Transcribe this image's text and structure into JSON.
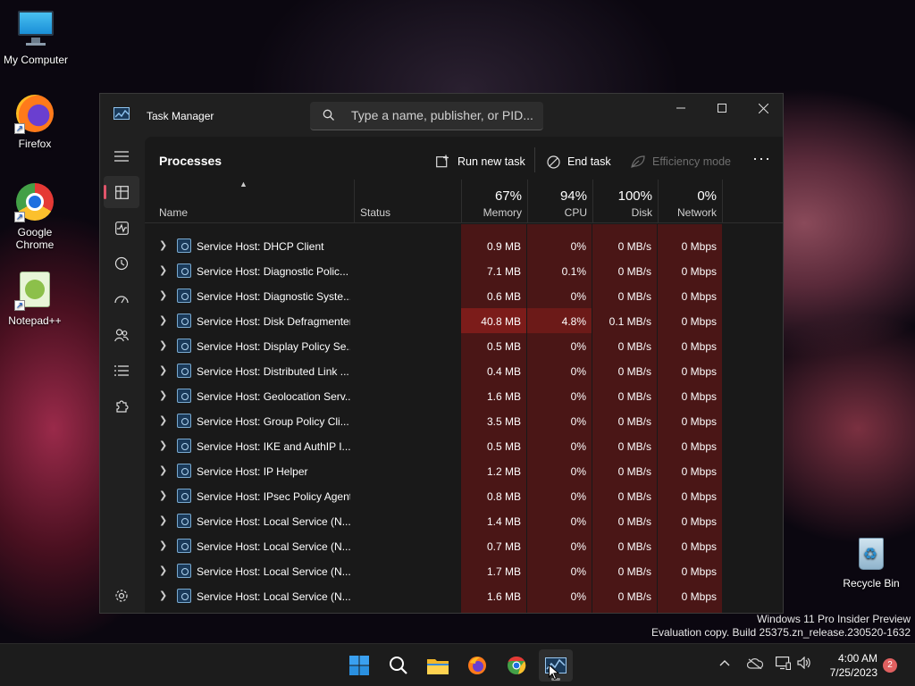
{
  "desktop": {
    "icons": [
      {
        "label": "My Computer",
        "icon": "computer-icon"
      },
      {
        "label": "Firefox",
        "icon": "firefox-icon"
      },
      {
        "label": "Google Chrome",
        "icon": "chrome-icon"
      },
      {
        "label": "Notepad++",
        "icon": "notepadpp-icon"
      },
      {
        "label": "Recycle Bin",
        "icon": "recycle-bin-icon"
      }
    ]
  },
  "window": {
    "title": "Task Manager",
    "search_placeholder": "Type a name, publisher, or PID..."
  },
  "toolbar": {
    "section_title": "Processes",
    "run_new_task": "Run new task",
    "end_task": "End task",
    "efficiency_mode": "Efficiency mode",
    "more": "···"
  },
  "columns": {
    "name": "Name",
    "status": "Status",
    "memory": {
      "label": "Memory",
      "pct": "67%"
    },
    "cpu": {
      "label": "CPU",
      "pct": "94%"
    },
    "disk": {
      "label": "Disk",
      "pct": "100%"
    },
    "network": {
      "label": "Network",
      "pct": "0%"
    }
  },
  "processes": [
    {
      "name": "Service Host: DHCP Client",
      "memory": "0.9 MB",
      "cpu": "0%",
      "disk": "0 MB/s",
      "network": "0 Mbps"
    },
    {
      "name": "Service Host: Diagnostic Polic...",
      "memory": "7.1 MB",
      "cpu": "0.1%",
      "disk": "0 MB/s",
      "network": "0 Mbps"
    },
    {
      "name": "Service Host: Diagnostic Syste...",
      "memory": "0.6 MB",
      "cpu": "0%",
      "disk": "0 MB/s",
      "network": "0 Mbps"
    },
    {
      "name": "Service Host: Disk Defragmenter",
      "memory": "40.8 MB",
      "cpu": "4.8%",
      "disk": "0.1 MB/s",
      "network": "0 Mbps",
      "hot": true
    },
    {
      "name": "Service Host: Display Policy Se...",
      "memory": "0.5 MB",
      "cpu": "0%",
      "disk": "0 MB/s",
      "network": "0 Mbps"
    },
    {
      "name": "Service Host: Distributed Link ...",
      "memory": "0.4 MB",
      "cpu": "0%",
      "disk": "0 MB/s",
      "network": "0 Mbps"
    },
    {
      "name": "Service Host: Geolocation Serv...",
      "memory": "1.6 MB",
      "cpu": "0%",
      "disk": "0 MB/s",
      "network": "0 Mbps"
    },
    {
      "name": "Service Host: Group Policy Cli...",
      "memory": "3.5 MB",
      "cpu": "0%",
      "disk": "0 MB/s",
      "network": "0 Mbps"
    },
    {
      "name": "Service Host: IKE and AuthIP I...",
      "memory": "0.5 MB",
      "cpu": "0%",
      "disk": "0 MB/s",
      "network": "0 Mbps"
    },
    {
      "name": "Service Host: IP Helper",
      "memory": "1.2 MB",
      "cpu": "0%",
      "disk": "0 MB/s",
      "network": "0 Mbps"
    },
    {
      "name": "Service Host: IPsec Policy Agent",
      "memory": "0.8 MB",
      "cpu": "0%",
      "disk": "0 MB/s",
      "network": "0 Mbps"
    },
    {
      "name": "Service Host: Local Service (N...",
      "memory": "1.4 MB",
      "cpu": "0%",
      "disk": "0 MB/s",
      "network": "0 Mbps"
    },
    {
      "name": "Service Host: Local Service (N...",
      "memory": "0.7 MB",
      "cpu": "0%",
      "disk": "0 MB/s",
      "network": "0 Mbps"
    },
    {
      "name": "Service Host: Local Service (N...",
      "memory": "1.7 MB",
      "cpu": "0%",
      "disk": "0 MB/s",
      "network": "0 Mbps"
    },
    {
      "name": "Service Host: Local Service (N...",
      "memory": "1.6 MB",
      "cpu": "0%",
      "disk": "0 MB/s",
      "network": "0 Mbps"
    }
  ],
  "watermark": {
    "line1": "Windows 11 Pro Insider Preview",
    "line2": "Evaluation copy. Build 25375.zn_release.230520-1632"
  },
  "taskbar": {
    "time": "4:00 AM",
    "date": "7/25/2023",
    "notification_count": "2"
  },
  "colors": {
    "heat_low": "#4a1616",
    "heat_high": "#7c1c1a",
    "accent": "#e0546a"
  }
}
